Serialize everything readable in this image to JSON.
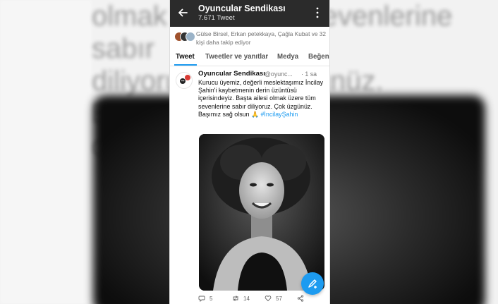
{
  "background": {
    "blurred_text": "olmak üzere tüm sevenlerine sabır\ndiliyoruz. Çok üzgünüz. Başımız sağ\nolsun 🙏"
  },
  "header": {
    "title": "Oyuncular Sendikası",
    "subtitle": "7.671 Tweet",
    "bar_color": "#2b2b2b"
  },
  "followed_by": {
    "text": "Gülse Birsel, Erkan petekkaya, Çağla Kubat ve 32 kişi daha takip ediyor"
  },
  "tabs": [
    {
      "label": "Tweet",
      "active": true
    },
    {
      "label": "Tweetler ve yanıtlar",
      "active": false
    },
    {
      "label": "Medya",
      "active": false
    },
    {
      "label": "Beğeni",
      "active": false
    }
  ],
  "tweet": {
    "name": "Oyuncular Sendikası",
    "handle": "@oyunc...",
    "time": "· 1 sa",
    "text": "Kurucu üyemiz, değerli meslektaşımız İncilay Şahin'i kaybetmenin derin üzüntüsü içerisindeyiz. Başta ailesi olmak üzere tüm sevenlerine sabır diliyoruz. Çok üzgünüz. Başımız sağ olsun 🙏",
    "hashtag": "#İncilayŞahin",
    "replies": "5",
    "retweets": "14",
    "likes": "57"
  },
  "colors": {
    "accent": "#1d9bf0"
  },
  "icons": [
    "back-arrow-icon",
    "more-vertical-icon",
    "reply-icon",
    "retweet-icon",
    "like-icon",
    "share-icon",
    "compose-icon"
  ]
}
